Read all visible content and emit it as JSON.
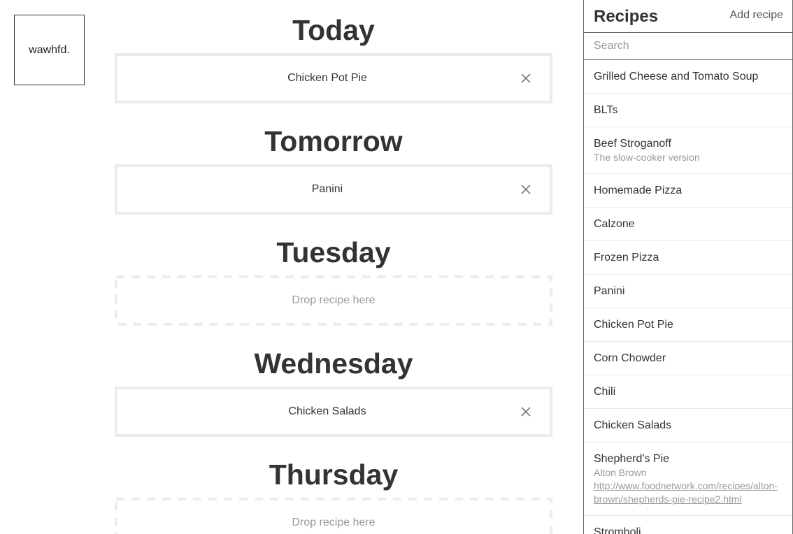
{
  "logo": {
    "text": "wawhfd."
  },
  "planner": {
    "days": [
      {
        "title": "Today",
        "recipe": "Chicken Pot Pie",
        "filled": true
      },
      {
        "title": "Tomorrow",
        "recipe": "Panini",
        "filled": true
      },
      {
        "title": "Tuesday",
        "placeholder": "Drop recipe here",
        "filled": false
      },
      {
        "title": "Wednesday",
        "recipe": "Chicken Salads",
        "filled": true
      },
      {
        "title": "Thursday",
        "placeholder": "Drop recipe here",
        "filled": false
      }
    ]
  },
  "sidebar": {
    "title": "Recipes",
    "add_label": "Add recipe",
    "search_placeholder": "Search",
    "recipes": [
      {
        "name": "Grilled Cheese and Tomato Soup"
      },
      {
        "name": "BLTs"
      },
      {
        "name": "Beef Stroganoff",
        "note": "The slow-cooker version"
      },
      {
        "name": "Homemade Pizza"
      },
      {
        "name": "Calzone"
      },
      {
        "name": "Frozen Pizza"
      },
      {
        "name": "Panini"
      },
      {
        "name": "Chicken Pot Pie"
      },
      {
        "name": "Corn Chowder"
      },
      {
        "name": "Chili"
      },
      {
        "name": "Chicken Salads"
      },
      {
        "name": "Shepherd's Pie",
        "note": "Alton Brown",
        "link_line1": "http://www.foodnetwork.com/recipes/alton-",
        "link_line2": "brown/shepherds-pie-recipe2.html"
      },
      {
        "name": "Stromboli"
      }
    ]
  },
  "colors": {
    "text": "#333333",
    "muted": "#999999",
    "slot_border": "#ececec",
    "divider": "#666666"
  },
  "icons": {
    "remove": "close-icon"
  }
}
